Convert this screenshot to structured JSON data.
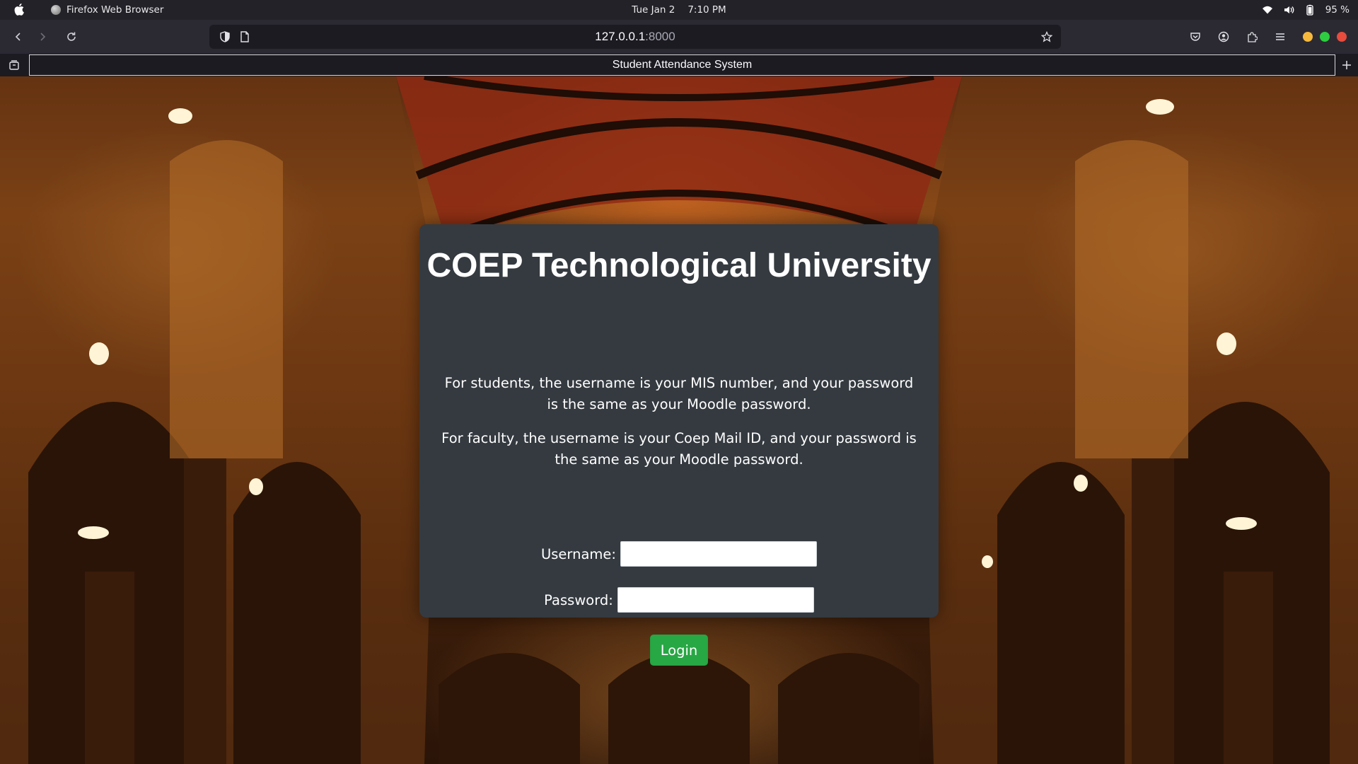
{
  "system_bar": {
    "app_name": "Firefox Web Browser",
    "date": "Tue Jan 2",
    "time": "7:10 PM",
    "battery": "95 %"
  },
  "toolbar": {
    "url_host": "127.0.0.1",
    "url_port": ":8000",
    "window_controls": {
      "minimize_color": "#f6b93b",
      "maximize_color": "#2ecc40",
      "close_color": "#e74c3c"
    }
  },
  "tab": {
    "title": "Student Attendance System"
  },
  "login": {
    "heading": "COEP Technological University",
    "student_note": "For students, the username is your MIS number, and your password is the same as your Moodle password.",
    "faculty_note": "For faculty, the username is your Coep Mail ID, and your password is the same as your Moodle password.",
    "username_label": "Username:",
    "username_value": "",
    "password_label": "Password:",
    "password_value": "",
    "login_button": "Login"
  },
  "colors": {
    "card_bg": "#343a40",
    "button_green": "#28a745"
  }
}
